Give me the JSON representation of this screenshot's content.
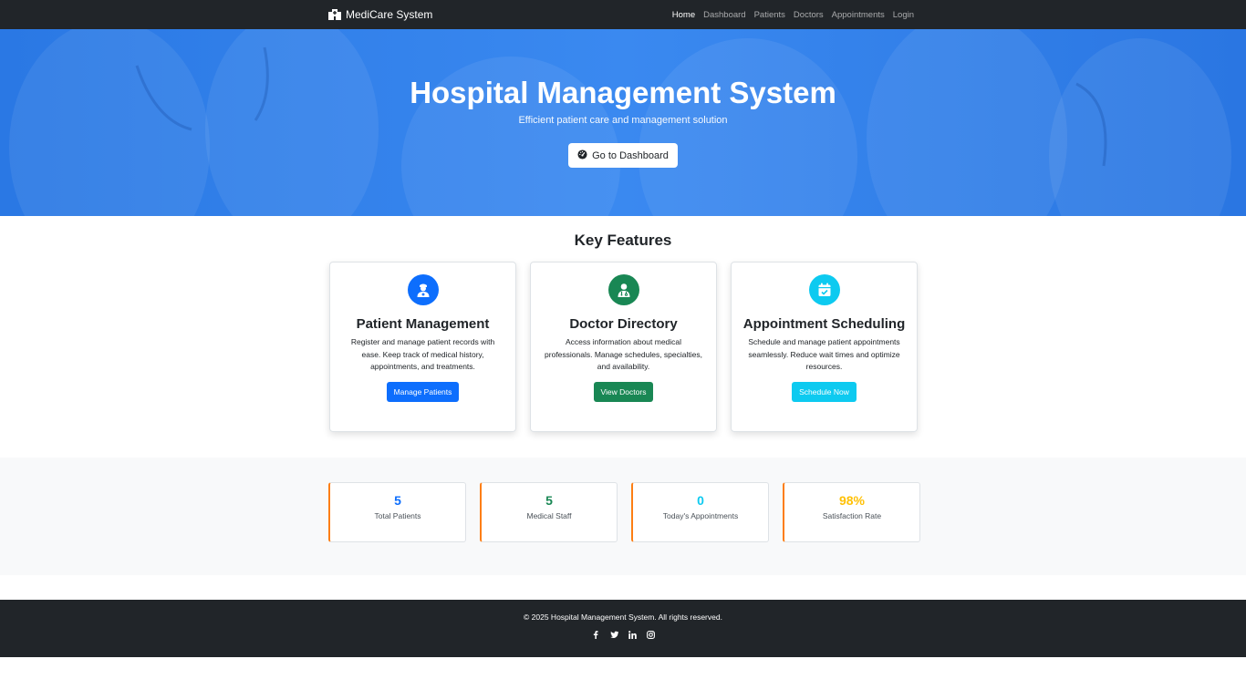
{
  "navbar": {
    "brand": "MediCare System",
    "links": [
      "Home",
      "Dashboard",
      "Patients",
      "Doctors",
      "Appointments",
      "Login"
    ],
    "active": "Home"
  },
  "hero": {
    "title": "Hospital Management System",
    "subtitle": "Efficient patient care and management solution",
    "button": "Go to Dashboard"
  },
  "features": {
    "title": "Key Features",
    "cards": [
      {
        "title": "Patient Management",
        "text": "Register and manage patient records with ease. Keep track of medical history, appointments, and treatments.",
        "button": "Manage Patients",
        "color": "#0d6efd",
        "icon": "user-nurse-icon"
      },
      {
        "title": "Doctor Directory",
        "text": "Access information about medical professionals. Manage schedules, specialties, and availability.",
        "button": "View Doctors",
        "color": "#198754",
        "icon": "user-doctor-icon"
      },
      {
        "title": "Appointment Scheduling",
        "text": "Schedule and manage patient appointments seamlessly. Reduce wait times and optimize resources.",
        "button": "Schedule Now",
        "color": "#0dcaf0",
        "icon": "calendar-check-icon"
      }
    ]
  },
  "stats": [
    {
      "value": "5",
      "label": "Total Patients",
      "color": "#0d6efd"
    },
    {
      "value": "5",
      "label": "Medical Staff",
      "color": "#198754"
    },
    {
      "value": "0",
      "label": "Today's Appointments",
      "color": "#0dcaf0"
    },
    {
      "value": "98%",
      "label": "Satisfaction Rate",
      "color": "#ffc107"
    }
  ],
  "footer": {
    "text": "© 2025 Hospital Management System. All rights reserved.",
    "socials": [
      "facebook-icon",
      "twitter-icon",
      "linkedin-icon",
      "instagram-icon"
    ]
  }
}
